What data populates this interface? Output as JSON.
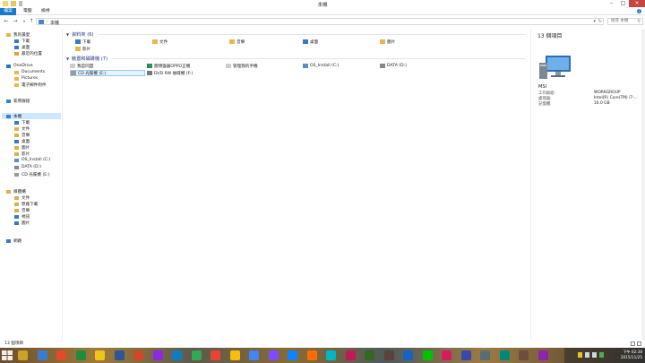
{
  "window": {
    "title": "本機"
  },
  "ribbon": {
    "tabs": [
      "檔案",
      "電腦",
      "檢視"
    ]
  },
  "address": {
    "path": "本機",
    "search_placeholder": "搜尋 本機"
  },
  "sidebar": {
    "items": [
      {
        "label": "我的最愛",
        "icon": "star-icon",
        "color": "#e8b534"
      },
      {
        "label": "下載",
        "icon": "download-folder-icon",
        "color": "#3a77c4"
      },
      {
        "label": "桌面",
        "icon": "desktop-folder-icon",
        "color": "#3a77c4"
      },
      {
        "label": "最近的位置",
        "icon": "recent-places-icon",
        "color": "#e0a33a"
      },
      {
        "label": "OneDrive",
        "icon": "cloud-icon",
        "color": "#2d6fcc"
      },
      {
        "label": "Documents",
        "icon": "folder-icon",
        "color": "#e3b84c"
      },
      {
        "label": "Pictures",
        "icon": "folder-icon",
        "color": "#e3b84c"
      },
      {
        "label": "電子郵件附件",
        "icon": "folder-icon",
        "color": "#e3b84c"
      },
      {
        "label": "家用群組",
        "icon": "homegroup-icon",
        "color": "#2d88c9"
      },
      {
        "label": "本機",
        "icon": "computer-icon",
        "color": "#3f7fc2"
      },
      {
        "label": "下載",
        "icon": "download-folder-icon",
        "color": "#3a77c4"
      },
      {
        "label": "文件",
        "icon": "documents-folder-icon",
        "color": "#d9b04a"
      },
      {
        "label": "音樂",
        "icon": "music-folder-icon",
        "color": "#d9b04a"
      },
      {
        "label": "桌面",
        "icon": "desktop-folder-icon",
        "color": "#3a77c4"
      },
      {
        "label": "圖片",
        "icon": "pictures-folder-icon",
        "color": "#d9b04a"
      },
      {
        "label": "影片",
        "icon": "videos-folder-icon",
        "color": "#d9b04a"
      },
      {
        "label": "OS_Install (C:)",
        "icon": "windows-drive-icon",
        "color": "#5a8fc8"
      },
      {
        "label": "DATA (D:)",
        "icon": "drive-icon",
        "color": "#888888"
      },
      {
        "label": "CD 光碟機 (E:)",
        "icon": "cd-drive-icon",
        "color": "#999999"
      },
      {
        "label": "媒體櫃",
        "icon": "libraries-icon",
        "color": "#d9b04a"
      },
      {
        "label": "文件",
        "icon": "documents-folder-icon",
        "color": "#d9b04a"
      },
      {
        "label": "原廠下載",
        "icon": "folder-icon",
        "color": "#d9b04a"
      },
      {
        "label": "音樂",
        "icon": "music-folder-icon",
        "color": "#d9b04a"
      },
      {
        "label": "視訊",
        "icon": "videos-folder-icon",
        "color": "#3a77c4"
      },
      {
        "label": "圖片",
        "icon": "pictures-folder-icon",
        "color": "#3a77c4"
      },
      {
        "label": "網路",
        "icon": "network-icon",
        "color": "#3a77c4"
      }
    ]
  },
  "groups": {
    "folders": {
      "heading": "資料夾 (6)",
      "items": [
        {
          "label": "下載",
          "icon": "download-folder-icon",
          "color": "#3a77c4"
        },
        {
          "label": "文件",
          "icon": "documents-folder-icon",
          "color": "#e3b84c"
        },
        {
          "label": "音樂",
          "icon": "music-folder-icon",
          "color": "#e3b84c"
        },
        {
          "label": "桌面",
          "icon": "desktop-folder-icon",
          "color": "#3a77c4"
        },
        {
          "label": "圖片",
          "icon": "pictures-folder-icon",
          "color": "#e3b84c"
        },
        {
          "label": "影片",
          "icon": "videos-folder-icon",
          "color": "#e3b84c"
        }
      ]
    },
    "devices": {
      "heading": "裝置和磁碟機 (7)",
      "items": [
        {
          "label": "我是同盟",
          "icon": "file-icon",
          "color": "#cccccc"
        },
        {
          "label": "圖博盤器OPPO正機",
          "icon": "phone-icon",
          "color": "#2e8a57"
        },
        {
          "label": "管理我的手機",
          "icon": "file-icon",
          "color": "#cccccc"
        },
        {
          "label": "OS_Install (C:)",
          "icon": "windows-drive-icon",
          "color": "#5a8fc8"
        },
        {
          "label": "DATA (D:)",
          "icon": "drive-icon",
          "color": "#888888"
        },
        {
          "label": "CD 光碟機 (E:)",
          "icon": "cd-drive-icon",
          "color": "#999999"
        },
        {
          "label": "DVD RW 磁碟機 (F:)",
          "icon": "dvd-drive-icon",
          "color": "#777777"
        }
      ]
    }
  },
  "details": {
    "count": "13 個項目",
    "name": "MSI",
    "rows": [
      {
        "key": "工作群組:",
        "value": "WORKGROUP"
      },
      {
        "key": "處理器:",
        "value": "Intel(R) Core(TM) i7-..."
      },
      {
        "key": "記憶體:",
        "value": "16.0 GB"
      }
    ]
  },
  "status": {
    "text": "13 個項目"
  },
  "taskbar": {
    "apps": [
      "#c9a227",
      "#3a7bd5",
      "#e24a2b",
      "#1c8f3c",
      "#f0c419",
      "#2b5797",
      "#d24726",
      "#8a2be2",
      "#0f7dc2",
      "#34a853",
      "#ea4335",
      "#fbbc05",
      "#4285f4",
      "#7c4dff",
      "#0a84ff",
      "#ff6d00",
      "#00b7c3",
      "#c2185b",
      "#33691e",
      "#5d4037",
      "#1565c0",
      "#00c300",
      "#d81b60",
      "#3949ab",
      "#546e7a",
      "#00897b",
      "#6d4c41",
      "#8e24aa"
    ],
    "clock_time": "下午 02:38",
    "clock_date": "2015/11/25"
  }
}
